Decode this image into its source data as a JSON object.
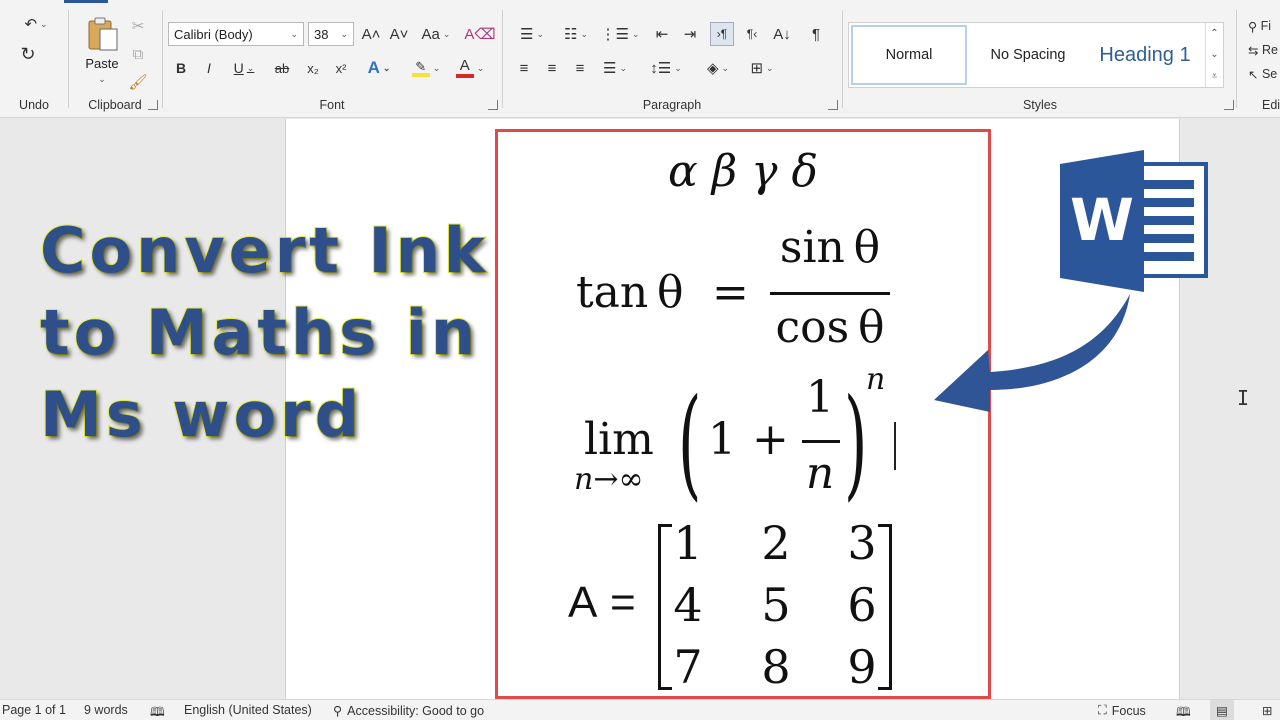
{
  "ribbon": {
    "undo_group": {
      "label": "Undo"
    },
    "clipboard_group": {
      "label": "Clipboard",
      "paste_label": "Paste"
    },
    "font_group": {
      "label": "Font",
      "font_name": "Calibri (Body)",
      "font_size": "38",
      "grow_font": "A˄",
      "shrink_font": "A˅",
      "change_case": "Aa",
      "bold": "B",
      "italic": "I",
      "underline": "U",
      "strikethrough": "ab",
      "subscript": "x₂",
      "superscript": "x²",
      "text_effects": "A",
      "font_color": "A"
    },
    "paragraph_group": {
      "label": "Paragraph"
    },
    "styles_group": {
      "label": "Styles",
      "styles": [
        "Normal",
        "No Spacing",
        "Heading 1"
      ]
    },
    "editing_group": {
      "items": [
        "Fi",
        "Re",
        "Se"
      ],
      "label": "Edi"
    }
  },
  "document": {
    "title_lines": [
      "Convert Ink",
      "to Maths in",
      "Ms word"
    ],
    "greek": "α  β  γ  δ",
    "eq1": {
      "lhs": "tan θ",
      "eq": "=",
      "num": "sin θ",
      "den": "cos θ"
    },
    "eq2": {
      "lim": "lim",
      "sub": "n→∞",
      "one": "1",
      "plus": "+",
      "num": "1",
      "den": "n",
      "exp": "n"
    },
    "matrix": {
      "label": "A",
      "eq": "=",
      "rows": [
        [
          "1",
          "2",
          "3"
        ],
        [
          "4",
          "5",
          "6"
        ],
        [
          "7",
          "8",
          "9"
        ]
      ]
    },
    "word_logo_letter": "W"
  },
  "statusbar": {
    "page": "Page 1 of 1",
    "words": "9 words",
    "language": "English (United States)",
    "accessibility": "Accessibility: Good to go",
    "focus": "Focus"
  },
  "colors": {
    "accent": "#2b579a",
    "highlight_border": "#e04a4a",
    "title_fill": "#2e4f8a",
    "title_stroke": "#e8ee3a",
    "word_blue": "#2b579a"
  }
}
